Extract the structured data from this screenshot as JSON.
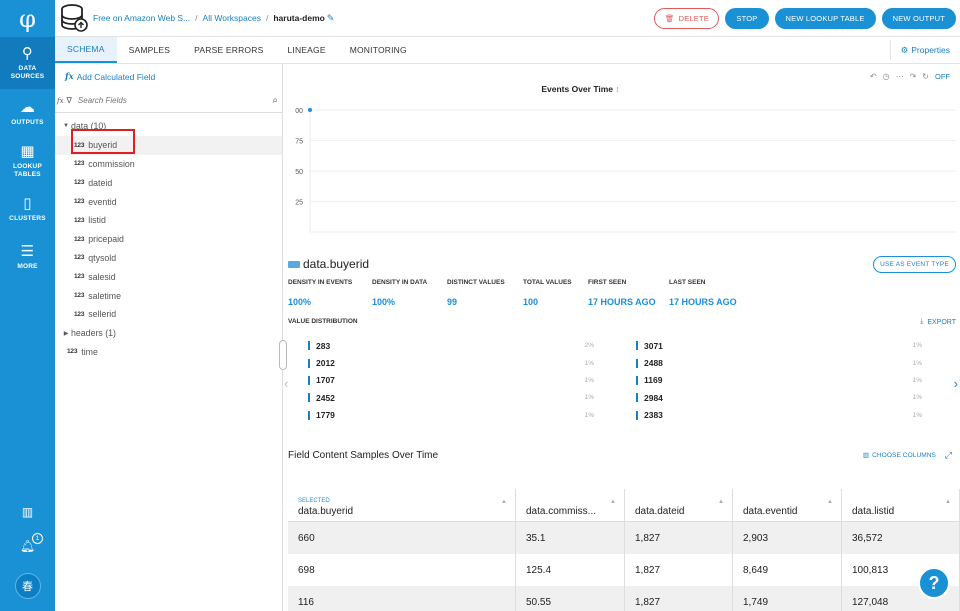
{
  "nav": {
    "logo": "φ",
    "items": [
      {
        "label": "DATA\nSOURCES",
        "icon": "data-sources-icon"
      },
      {
        "label": "OUTPUTS",
        "icon": "cloud-icon"
      },
      {
        "label": "LOOKUP\nTABLES",
        "icon": "grid-icon"
      },
      {
        "label": "CLUSTERS",
        "icon": "cluster-icon"
      },
      {
        "label": "MORE",
        "icon": "menu-icon"
      }
    ],
    "notification_count": "1",
    "avatar_initial": "春"
  },
  "header": {
    "breadcrumb": [
      "Free on Amazon Web S...",
      "All Workspaces"
    ],
    "current": "haruta-demo",
    "delete_label": "DELETE",
    "stop_label": "STOP",
    "lookup_label": "NEW LOOKUP TABLE",
    "output_label": "NEW OUTPUT"
  },
  "tabs": [
    "SCHEMA",
    "SAMPLES",
    "PARSE ERRORS",
    "LINEAGE",
    "MONITORING"
  ],
  "properties_label": "Properties",
  "fields_panel": {
    "add_calc_label": "Add Calculated Field",
    "search_placeholder": "Search Fields",
    "group_data": "data (10)",
    "fields": [
      "buyerid",
      "commission",
      "dateid",
      "eventid",
      "listid",
      "pricepaid",
      "qtysold",
      "salesid",
      "saletime",
      "sellerid"
    ],
    "type_label": "123",
    "group_headers": "headers (1)",
    "time_field": "time"
  },
  "chart": {
    "title": "Events Over Time",
    "off_label": "OFF",
    "y_ticks": [
      "00",
      "75",
      "50",
      "25"
    ]
  },
  "chart_data": {
    "type": "line",
    "title": "Events Over Time",
    "y_tick_labels": [
      "00",
      "75",
      "50",
      "25"
    ],
    "series": [
      {
        "values": [
          100
        ]
      }
    ],
    "grid": true
  },
  "field_detail": {
    "name": "data.buyerid",
    "use_as_label": "USE AS EVENT TYPE",
    "stats": [
      {
        "label": "DENSITY IN EVENTS",
        "value": "100%"
      },
      {
        "label": "DENSITY IN DATA",
        "value": "100%"
      },
      {
        "label": "DISTINCT VALUES",
        "value": "99"
      },
      {
        "label": "TOTAL VALUES",
        "value": "100"
      },
      {
        "label": "FIRST SEEN",
        "value": "17 HOURS AGO"
      },
      {
        "label": "LAST SEEN",
        "value": "17 HOURS AGO"
      }
    ],
    "value_distribution_label": "VALUE DISTRIBUTION",
    "export_label": "EXPORT",
    "dist_left": [
      {
        "v": "283",
        "p": "2%"
      },
      {
        "v": "2012",
        "p": "1%"
      },
      {
        "v": "1707",
        "p": "1%"
      },
      {
        "v": "2452",
        "p": "1%"
      },
      {
        "v": "1779",
        "p": "1%"
      }
    ],
    "dist_right": [
      {
        "v": "3071",
        "p": "1%"
      },
      {
        "v": "2488",
        "p": "1%"
      },
      {
        "v": "1169",
        "p": "1%"
      },
      {
        "v": "2984",
        "p": "1%"
      },
      {
        "v": "2383",
        "p": "1%"
      }
    ]
  },
  "samples": {
    "title": "Field Content Samples Over Time",
    "choose_columns_label": "CHOOSE COLUMNS",
    "selected_label": "SELECTED",
    "columns": [
      "data.buyerid",
      "data.commiss...",
      "data.dateid",
      "data.eventid",
      "data.listid"
    ],
    "rows": [
      [
        "660",
        "35.1",
        "1,827",
        "2,903",
        "36,572"
      ],
      [
        "698",
        "125.4",
        "1,827",
        "8,649",
        "100,813"
      ],
      [
        "116",
        "50.55",
        "1,827",
        "1,749",
        "127,048"
      ]
    ]
  },
  "help_label": "?"
}
